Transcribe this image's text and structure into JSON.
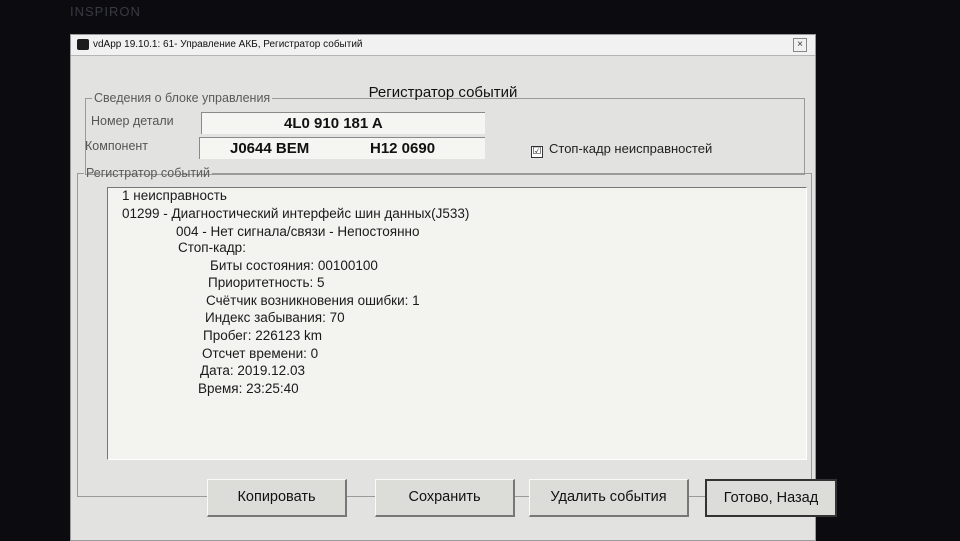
{
  "screen": {
    "bezel_label": "INSPIRON"
  },
  "window": {
    "title": "vdApp 19.10.1: 61- Управление АКБ, Регистратор событий",
    "close_glyph": "×"
  },
  "heading": "Регистратор событий",
  "ecu_info": {
    "legend": "Сведения о блоке управления",
    "part_number_label": "Номер детали",
    "part_number": "4L0 910 181 A",
    "component_label": "Компонент",
    "component_code": "J0644 BEM",
    "component_version": "H12 0690"
  },
  "freeze_frame_checkbox": {
    "label": "Стоп-кадр неисправностей",
    "checked": true,
    "mark": "☑"
  },
  "event_log": {
    "legend": "Регистратор событий",
    "lines": [
      "1 неисправность",
      "01299 - Диагностический интерфейс шин данных(J533)",
      "004 - Нет сигнала/связи - Непостоянно",
      "Стоп-кадр:",
      "Биты состояния: 00100100",
      "Приоритетность: 5",
      "Счётчик возникновения ошибки: 1",
      "Индекс забывания: 70",
      "Пробег: 226123 km",
      "Отсчет времени: 0",
      "Дата: 2019.12.03",
      "Время: 23:25:40"
    ]
  },
  "buttons": {
    "copy": "Копировать",
    "save": "Сохранить",
    "delete": "Удалить события",
    "done": "Готово, Назад"
  }
}
